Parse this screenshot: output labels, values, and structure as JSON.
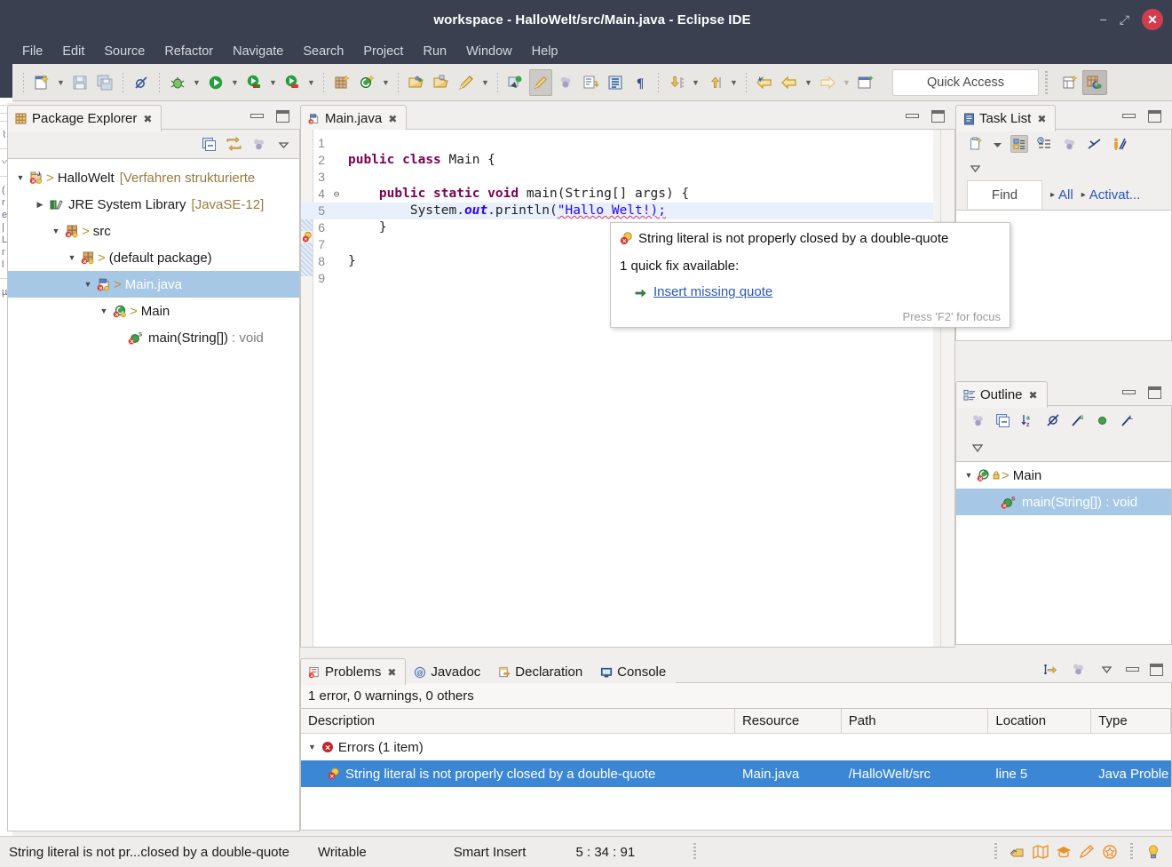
{
  "window": {
    "title": "workspace - HalloWelt/src/Main.java - Eclipse IDE",
    "minimize_label": "−",
    "maximize_label": "⤢",
    "close_label": "✕"
  },
  "menubar": {
    "items": [
      "File",
      "Edit",
      "Source",
      "Refactor",
      "Navigate",
      "Search",
      "Project",
      "Run",
      "Window",
      "Help"
    ]
  },
  "toolbar": {
    "quick_access_placeholder": "Quick Access",
    "icons": [
      "new-wizard-icon",
      "save-icon",
      "save-all-icon",
      "skip-all-breakpoints-icon",
      "debug-icon",
      "run-icon",
      "run-coverage-icon",
      "run-external-tools-icon",
      "new-java-project-icon",
      "new-java-class-icon",
      "open-type-icon",
      "open-task-icon",
      "toggle-markers-icon",
      "toggle-breadcrumb-icon",
      "toggle-block-selection-icon",
      "show-whitespace-icon",
      "toggle-word-wrap-icon",
      "pilcrow-icon",
      "next-annotation-icon",
      "previous-annotation-icon",
      "back-icon",
      "forward-icon",
      "new-editor-icon"
    ]
  },
  "package_explorer": {
    "tab_label": "Package Explorer",
    "toolbar_icons": [
      "collapse-all-icon",
      "link-with-editor-icon",
      "view-menu-dots-icon",
      "view-menu-icon"
    ],
    "tree": [
      {
        "indent": 0,
        "twisty": "▼",
        "icon": "java-project-error-icon",
        "gt": ">",
        "label": "HalloWelt",
        "suffix": "[Verfahren strukturierte",
        "selected": false
      },
      {
        "indent": 1,
        "twisty": "▶",
        "icon": "jre-library-icon",
        "gt": "",
        "label": "JRE System Library",
        "suffix": "[JavaSE-12]",
        "selected": false
      },
      {
        "indent": 2,
        "twisty": "▼",
        "icon": "source-folder-error-icon",
        "gt": ">",
        "label": "src",
        "suffix": "",
        "selected": false
      },
      {
        "indent": 3,
        "twisty": "▼",
        "icon": "package-error-icon",
        "gt": ">",
        "label": "(default package)",
        "suffix": "",
        "selected": false
      },
      {
        "indent": 4,
        "twisty": "▼",
        "icon": "java-file-error-icon",
        "gt": ">",
        "label": "Main.java",
        "suffix": "",
        "selected": true
      },
      {
        "indent": 5,
        "twisty": "▼",
        "icon": "java-class-error-icon",
        "gt": ">",
        "label": "Main",
        "suffix": "",
        "selected": false
      },
      {
        "indent": 6,
        "twisty": "",
        "icon": "java-method-static-error-icon",
        "gt": "",
        "label": "main(String[])",
        "suffix": ": void",
        "selected": false
      }
    ]
  },
  "editor": {
    "tab_label": "Main.java",
    "tab_close": "✕",
    "tab_icon": "java-file-error-icon",
    "lines": [
      {
        "n": "1",
        "fold": "",
        "segments": []
      },
      {
        "n": "2",
        "fold": "",
        "segments": [
          {
            "t": "public",
            "c": "kw"
          },
          {
            "t": " ",
            "c": ""
          },
          {
            "t": "class",
            "c": "kw"
          },
          {
            "t": " Main {",
            "c": ""
          }
        ]
      },
      {
        "n": "3",
        "fold": "",
        "segments": []
      },
      {
        "n": "4",
        "fold": "⊖",
        "segments": [
          {
            "t": "    ",
            "c": ""
          },
          {
            "t": "public",
            "c": "kw"
          },
          {
            "t": " ",
            "c": ""
          },
          {
            "t": "static",
            "c": "kw"
          },
          {
            "t": " ",
            "c": ""
          },
          {
            "t": "void",
            "c": "kw"
          },
          {
            "t": " main(String[] args) {",
            "c": ""
          }
        ]
      },
      {
        "n": "5",
        "fold": "",
        "highlight": true,
        "segments": [
          {
            "t": "        System.",
            "c": ""
          },
          {
            "t": "out",
            "c": "sf"
          },
          {
            "t": ".println(",
            "c": ""
          },
          {
            "t": "\"Hallo Welt!);",
            "c": "str err"
          }
        ]
      },
      {
        "n": "6",
        "fold": "",
        "segments": [
          {
            "t": "    }",
            "c": ""
          }
        ]
      },
      {
        "n": "7",
        "fold": "",
        "segments": []
      },
      {
        "n": "8",
        "fold": "",
        "segments": [
          {
            "t": "}",
            "c": ""
          }
        ]
      },
      {
        "n": "9",
        "fold": "",
        "segments": []
      }
    ]
  },
  "hover_popup": {
    "icon": "quickfix-error-icon",
    "message": "String literal is not properly closed by a double-quote",
    "subtitle": "1 quick fix available:",
    "fix_icon": "quickfix-arrow-icon",
    "fix_label": "Insert missing quote",
    "footer": "Press 'F2' for focus"
  },
  "task_list": {
    "tab_label": "Task List",
    "toolbar_icons": [
      "new-task-icon",
      "new-task-dropdown-icon",
      "categorized-presentation-icon",
      "scheduled-presentation-icon",
      "focus-on-workweek-icon",
      "collapse-all-icon",
      "synchronize-changed-icon"
    ],
    "find_label": "Find",
    "crumbs": [
      "All",
      "Activat..."
    ],
    "crumb_sep": "▸"
  },
  "outline": {
    "tab_label": "Outline",
    "toolbar_icons": [
      "focus-on-active-task-icon",
      "collapse-all-icon",
      "sort-icon",
      "hide-fields-icon",
      "hide-static-icon",
      "hide-non-public-icon",
      "hide-local-types-icon"
    ],
    "tree": [
      {
        "indent": 0,
        "twisty": "▼",
        "icon": "java-class-error-icon",
        "lock": "package-private-icon",
        "gt": ">",
        "label": "Main",
        "selected": false
      },
      {
        "indent": 1,
        "twisty": "",
        "icon": "java-method-static-error-icon",
        "gt": "",
        "label": "main(String[]) : void",
        "selected": true
      }
    ]
  },
  "problems": {
    "tabs": [
      {
        "label": "Problems",
        "icon": "problems-icon",
        "active": true,
        "close": "✕"
      },
      {
        "label": "Javadoc",
        "icon": "javadoc-icon",
        "active": false
      },
      {
        "label": "Declaration",
        "icon": "declaration-icon",
        "active": false
      },
      {
        "label": "Console",
        "icon": "console-icon",
        "active": false
      }
    ],
    "toolbar_icons": [
      "focus-on-selection-icon",
      "view-menu-dots-icon",
      "view-menu-icon"
    ],
    "summary": "1 error, 0 warnings, 0 others",
    "columns": [
      "Description",
      "Resource",
      "Path",
      "Location",
      "Type"
    ],
    "rows": [
      {
        "type": "group",
        "twisty": "▼",
        "icon": "error-group-icon",
        "description": "Errors (1 item)",
        "resource": "",
        "path": "",
        "location": "",
        "problem_type": "",
        "selected": false
      },
      {
        "type": "item",
        "twisty": "",
        "icon": "quickfix-error-icon",
        "description": "String literal is not properly closed by a double-quote",
        "resource": "Main.java",
        "path": "/HalloWelt/src",
        "location": "line 5",
        "problem_type": "Java Proble",
        "selected": true
      }
    ]
  },
  "statusbar": {
    "message": "String literal is not pr...closed by a double-quote",
    "writable": "Writable",
    "insert_mode": "Smart Insert",
    "position": "5 : 34 : 91",
    "icons": [
      "build-icon",
      "map-icon",
      "graduation-icon",
      "pencil-icon",
      "star-icon",
      "tip-icon"
    ]
  },
  "colors": {
    "titlebar_bg": "#3b4050",
    "close_btn": "#d03d4e",
    "selection_blue": "#a6c8e6",
    "table_selection": "#3b87d6",
    "link_blue": "#2a56b8",
    "keyword": "#7c0055",
    "string": "#2a00ff",
    "error_squiggle": "#e03a6a",
    "toolbar_bg": "#e9e7e4"
  }
}
